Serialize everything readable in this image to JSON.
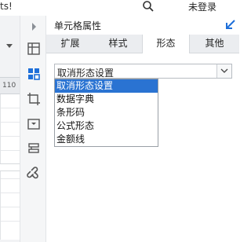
{
  "topbar": {
    "partial_text": "ts!",
    "login_label": "未登录"
  },
  "sheet": {
    "column_header": "110"
  },
  "toolbar": {
    "icons": [
      "chevron-right-icon",
      "cell-grid-icon",
      "widget-icon",
      "crop-icon",
      "dropdown-box-icon",
      "layers-icon",
      "link-icon"
    ]
  },
  "panel": {
    "title": "单元格属性",
    "tabs": [
      "扩展",
      "样式",
      "形态",
      "其他"
    ],
    "active_tab": "形态",
    "select": {
      "value": "取消形态设置",
      "options": [
        "取消形态设置",
        "数据字典",
        "条形码",
        "公式形态",
        "金额线"
      ],
      "selected_index": 0
    }
  },
  "colors": {
    "selection": "#2a73d2",
    "accent": "#1e6fd9",
    "tab_bar": "#ebedf0"
  }
}
